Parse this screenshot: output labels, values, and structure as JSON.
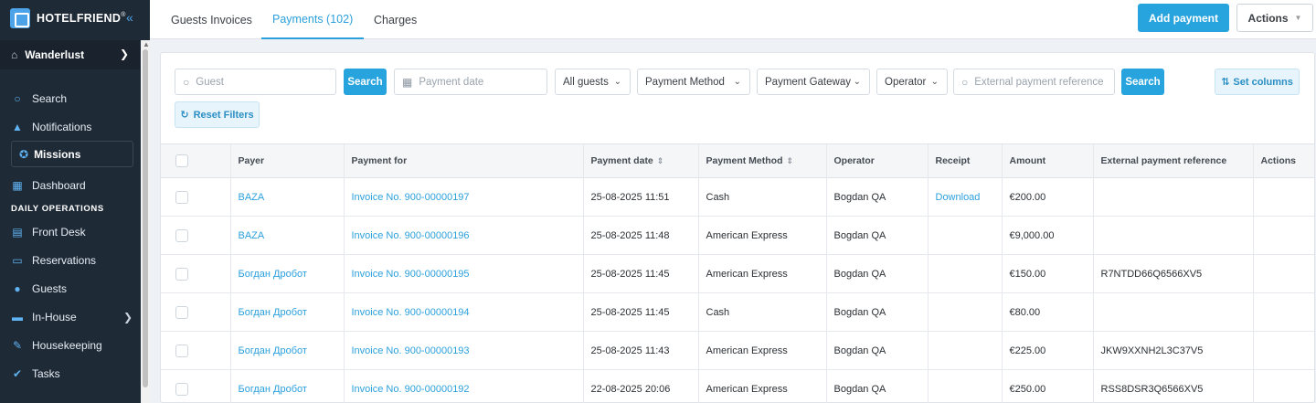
{
  "brand": {
    "name": "HOTELFRIEND",
    "reg": "®"
  },
  "property": {
    "name": "Wanderlust"
  },
  "sidebar": {
    "items_top": [
      {
        "label": "Search",
        "icon": "search-icon"
      },
      {
        "label": "Notifications",
        "icon": "bell-icon"
      }
    ],
    "missions": {
      "label": "Missions"
    },
    "dashboard": {
      "label": "Dashboard"
    },
    "section_label": "DAILY OPERATIONS",
    "ops": [
      {
        "label": "Front Desk"
      },
      {
        "label": "Reservations"
      },
      {
        "label": "Guests"
      },
      {
        "label": "In-House"
      },
      {
        "label": "Housekeeping"
      },
      {
        "label": "Tasks"
      }
    ]
  },
  "tabs": [
    {
      "label": "Guests Invoices"
    },
    {
      "label": "Payments (102)"
    },
    {
      "label": "Charges"
    }
  ],
  "header": {
    "add_payment": "Add payment",
    "actions": "Actions"
  },
  "filters": {
    "guest_placeholder": "Guest",
    "search_label": "Search",
    "date_placeholder": "Payment date",
    "all_guests": "All guests",
    "payment_method": "Payment Method",
    "payment_gateway": "Payment Gateway",
    "operator": "Operator",
    "ext_ref_placeholder": "External payment reference",
    "search2_label": "Search",
    "set_columns": "Set columns",
    "reset_filters": "Reset Filters"
  },
  "table": {
    "columns": [
      "Payer",
      "Payment for",
      "Payment date",
      "Payment Method",
      "Operator",
      "Receipt",
      "Amount",
      "External payment reference",
      "Actions"
    ],
    "rows": [
      {
        "payer": "BAZA",
        "payment_for": "Invoice No. 900-00000197",
        "date": "25-08-2025 11:51",
        "method": "Cash",
        "operator": "Bogdan QA",
        "receipt": "Download",
        "amount": "€200.00",
        "ext_ref": ""
      },
      {
        "payer": "BAZA",
        "payment_for": "Invoice No. 900-00000196",
        "date": "25-08-2025 11:48",
        "method": "American Express",
        "operator": "Bogdan QA",
        "receipt": "",
        "amount": "€9,000.00",
        "ext_ref": ""
      },
      {
        "payer": "Богдан Дробот",
        "payment_for": "Invoice No. 900-00000195",
        "date": "25-08-2025 11:45",
        "method": "American Express",
        "operator": "Bogdan QA",
        "receipt": "",
        "amount": "€150.00",
        "ext_ref": "R7NTDD66Q6566XV5"
      },
      {
        "payer": "Богдан Дробот",
        "payment_for": "Invoice No. 900-00000194",
        "date": "25-08-2025 11:45",
        "method": "Cash",
        "operator": "Bogdan QA",
        "receipt": "",
        "amount": "€80.00",
        "ext_ref": ""
      },
      {
        "payer": "Богдан Дробот",
        "payment_for": "Invoice No. 900-00000193",
        "date": "25-08-2025 11:43",
        "method": "American Express",
        "operator": "Bogdan QA",
        "receipt": "",
        "amount": "€225.00",
        "ext_ref": "JKW9XXNH2L3C37V5"
      },
      {
        "payer": "Богдан Дробот",
        "payment_for": "Invoice No. 900-00000192",
        "date": "22-08-2025 20:06",
        "method": "American Express",
        "operator": "Bogdan QA",
        "receipt": "",
        "amount": "€250.00",
        "ext_ref": "RSS8DSR3Q6566XV5"
      }
    ]
  },
  "colors": {
    "accent": "#27a4de",
    "sidebar": "#1f2a37",
    "link": "#2ba0dc"
  }
}
